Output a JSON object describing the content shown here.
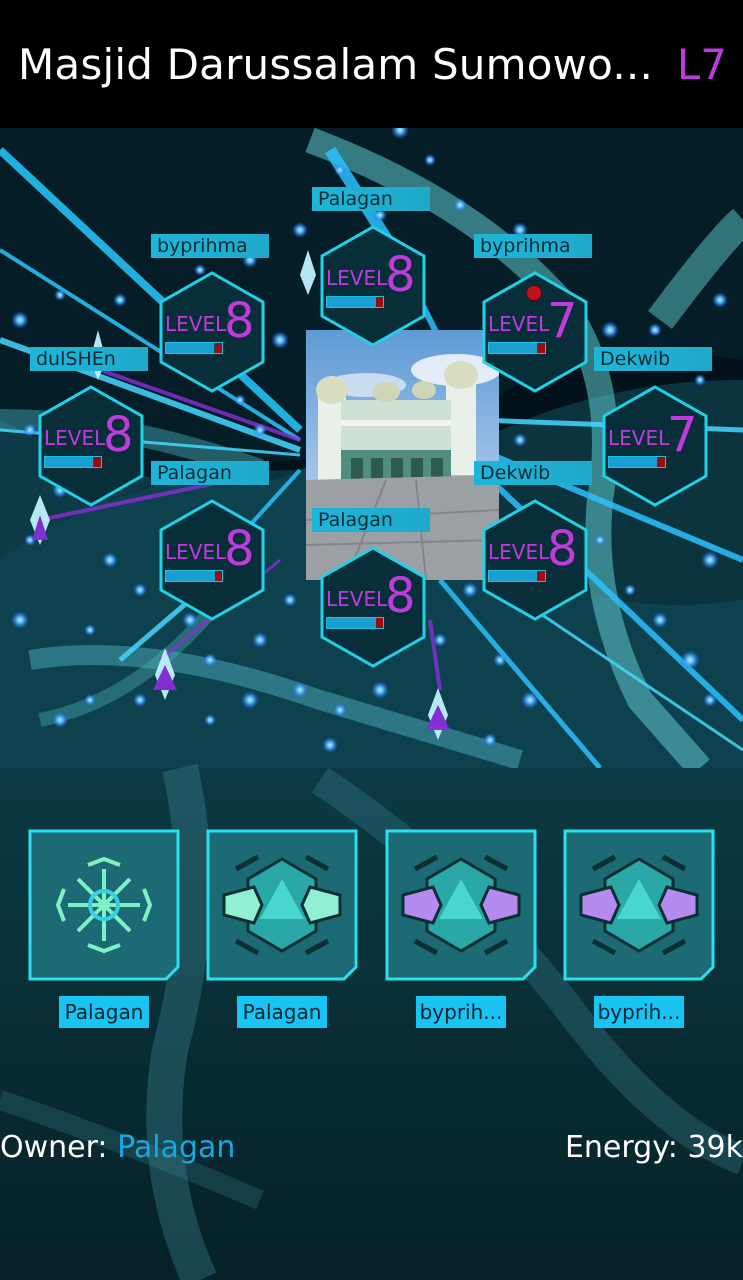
{
  "portal": {
    "title": "Masjid Darussalam Sumowo...",
    "level": "L7",
    "owner_label": "Owner:",
    "owner_name": "Palagan",
    "energy_label": "Energy:",
    "energy_value": "39k"
  },
  "resonator_word": "LEVEL",
  "resonators": [
    {
      "slot": "N",
      "owner": "Palagan",
      "level": "8",
      "energy_fraction": 0.9
    },
    {
      "slot": "NE",
      "owner": "byprihma",
      "level": "7",
      "energy_fraction": 0.85
    },
    {
      "slot": "E",
      "owner": "Dekwib",
      "level": "7",
      "energy_fraction": 0.85
    },
    {
      "slot": "SE",
      "owner": "Dekwib",
      "level": "8",
      "energy_fraction": 0.85
    },
    {
      "slot": "S",
      "owner": "Palagan",
      "level": "8",
      "energy_fraction": 0.9
    },
    {
      "slot": "SW",
      "owner": "Palagan",
      "level": "8",
      "energy_fraction": 0.9
    },
    {
      "slot": "W",
      "owner": "dulSHEn",
      "level": "8",
      "energy_fraction": 0.85
    },
    {
      "slot": "NW",
      "owner": "byprihma",
      "level": "8",
      "energy_fraction": 0.85
    }
  ],
  "mods": [
    {
      "type": "link-amp-icon",
      "owner": "Palagan"
    },
    {
      "type": "shield-icon",
      "owner": "Palagan"
    },
    {
      "type": "shield-icon",
      "owner": "byprih..."
    },
    {
      "type": "shield-icon",
      "owner": "byprih..."
    }
  ],
  "colors": {
    "title": "#ffffff",
    "level_magenta": "#c03bdc",
    "resistance_blue": "#1aa6de",
    "owner_tag_bg": "#1eb6d8",
    "mod_label_bg": "#17c4f2",
    "resonator_hex_border": "#1fd2e8",
    "resonator_hex_fill": "#082e3a",
    "bar_fill": "#1b9fd3",
    "bar_end_red": "#9c0b10"
  }
}
